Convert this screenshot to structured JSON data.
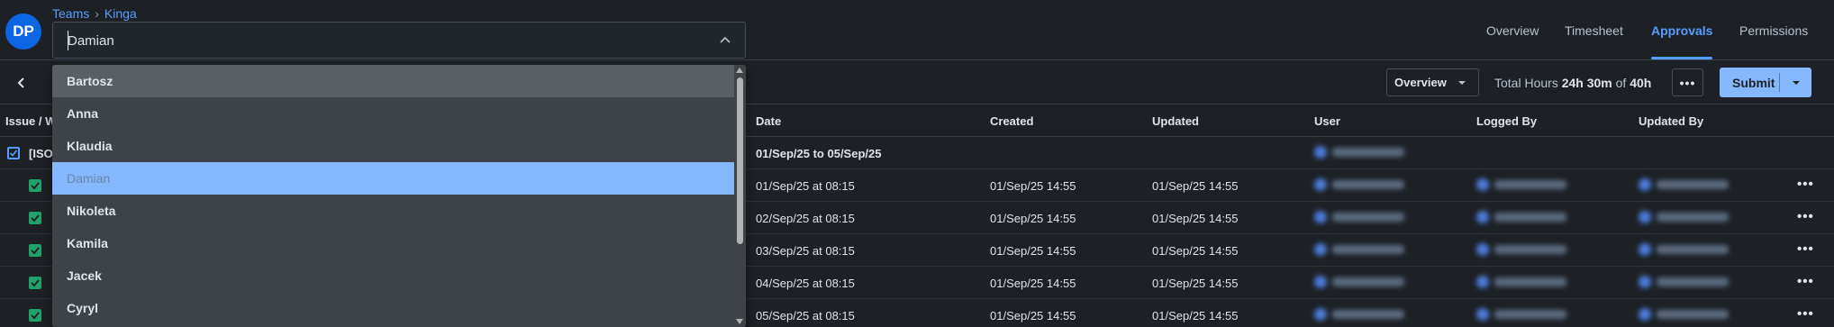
{
  "header": {
    "avatar_initials": "DP",
    "breadcrumb": {
      "teams": "Teams",
      "separator": "›",
      "current": "Kinga"
    },
    "team_select": {
      "value": "Damian"
    },
    "tabs": [
      {
        "label": "Overview",
        "active": false
      },
      {
        "label": "Timesheet",
        "active": false
      },
      {
        "label": "Approvals",
        "active": true
      },
      {
        "label": "Permissions",
        "active": false
      }
    ]
  },
  "toolbar": {
    "view_select": "Overview",
    "total_hours_label": "Total Hours",
    "total_hours_value": "24h 30m",
    "total_hours_of": "of",
    "total_hours_target": "40h",
    "more_label": "•••",
    "submit_label": "Submit"
  },
  "table": {
    "columns": {
      "issue": "Issue / W",
      "date": "Date",
      "created": "Created",
      "updated": "Updated",
      "user": "User",
      "logged_by": "Logged By",
      "updated_by": "Updated By"
    },
    "group": {
      "issue": "[ISO",
      "date_range": "01/Sep/25 to 05/Sep/25"
    },
    "rows": [
      {
        "date": "01/Sep/25 at 08:15",
        "created": "01/Sep/25 14:55",
        "updated": "01/Sep/25 14:55"
      },
      {
        "date": "02/Sep/25 at 08:15",
        "created": "01/Sep/25 14:55",
        "updated": "01/Sep/25 14:55"
      },
      {
        "date": "03/Sep/25 at 08:15",
        "created": "01/Sep/25 14:55",
        "updated": "01/Sep/25 14:55"
      },
      {
        "date": "04/Sep/25 at 08:15",
        "created": "01/Sep/25 14:55",
        "updated": "01/Sep/25 14:55"
      },
      {
        "date": "05/Sep/25 at 08:15",
        "created": "01/Sep/25 14:55",
        "updated": "01/Sep/25 14:55"
      }
    ],
    "row_more_label": "•••"
  },
  "dropdown": {
    "options": [
      "Bartosz",
      "Anna",
      "Klaudia",
      "Damian",
      "Nikoleta",
      "Kamila",
      "Jacek",
      "Cyryl"
    ],
    "hovered": "Bartosz",
    "selected": "Damian"
  },
  "colors": {
    "background": "#1d2125",
    "accent": "#579dff",
    "avatar": "#0c66e4",
    "submit": "#85b8ff",
    "checkbox_checked": "#22a06b",
    "selected_option": "#85b8ff"
  }
}
